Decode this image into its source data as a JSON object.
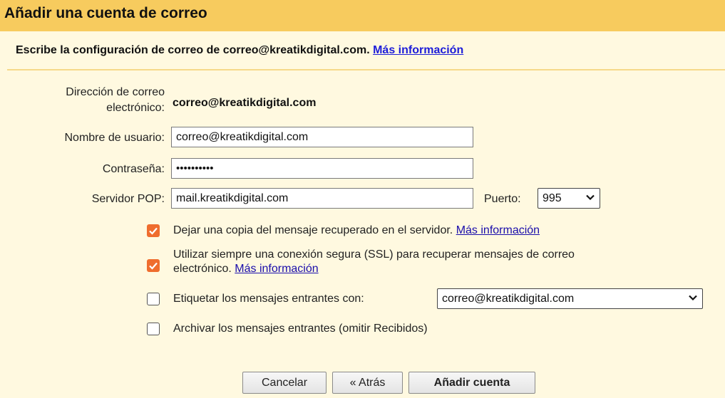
{
  "header": {
    "title": "Añadir una cuenta de correo"
  },
  "subtitle": {
    "text": "Escribe la configuración de correo de correo@kreatikdigital.com.",
    "link": "Más información"
  },
  "form": {
    "email_label_line1": "Dirección de correo",
    "email_label_line2": "electrónico:",
    "email_value": "correo@kreatikdigital.com",
    "username_label": "Nombre de usuario:",
    "username_value": "correo@kreatikdigital.com",
    "password_label": "Contraseña:",
    "password_value": "••••••••••",
    "pop_label": "Servidor POP:",
    "pop_value": "mail.kreatikdigital.com",
    "port_label": "Puerto:",
    "port_value": "995"
  },
  "options": [
    {
      "label": "Dejar una copia del mensaje recuperado en el servidor.",
      "link": "Más información",
      "checked": true
    },
    {
      "label_line1": "Utilizar siempre una conexión segura (SSL) para recuperar mensajes de correo",
      "label_line2": "electrónico.",
      "link": "Más información",
      "checked": true
    },
    {
      "label": "Etiquetar los mensajes entrantes con:",
      "select_value": "correo@kreatikdigital.com",
      "checked": false
    },
    {
      "label": "Archivar los mensajes entrantes (omitir Recibidos)",
      "checked": false
    }
  ],
  "buttons": {
    "cancel": "Cancelar",
    "back": "« Atrás",
    "add": "Añadir cuenta"
  },
  "colors": {
    "header_bg": "#f7cb5e",
    "body_bg": "#fff9e0",
    "checkbox_checked": "#ef6d2e",
    "link": "#1a0dab"
  }
}
